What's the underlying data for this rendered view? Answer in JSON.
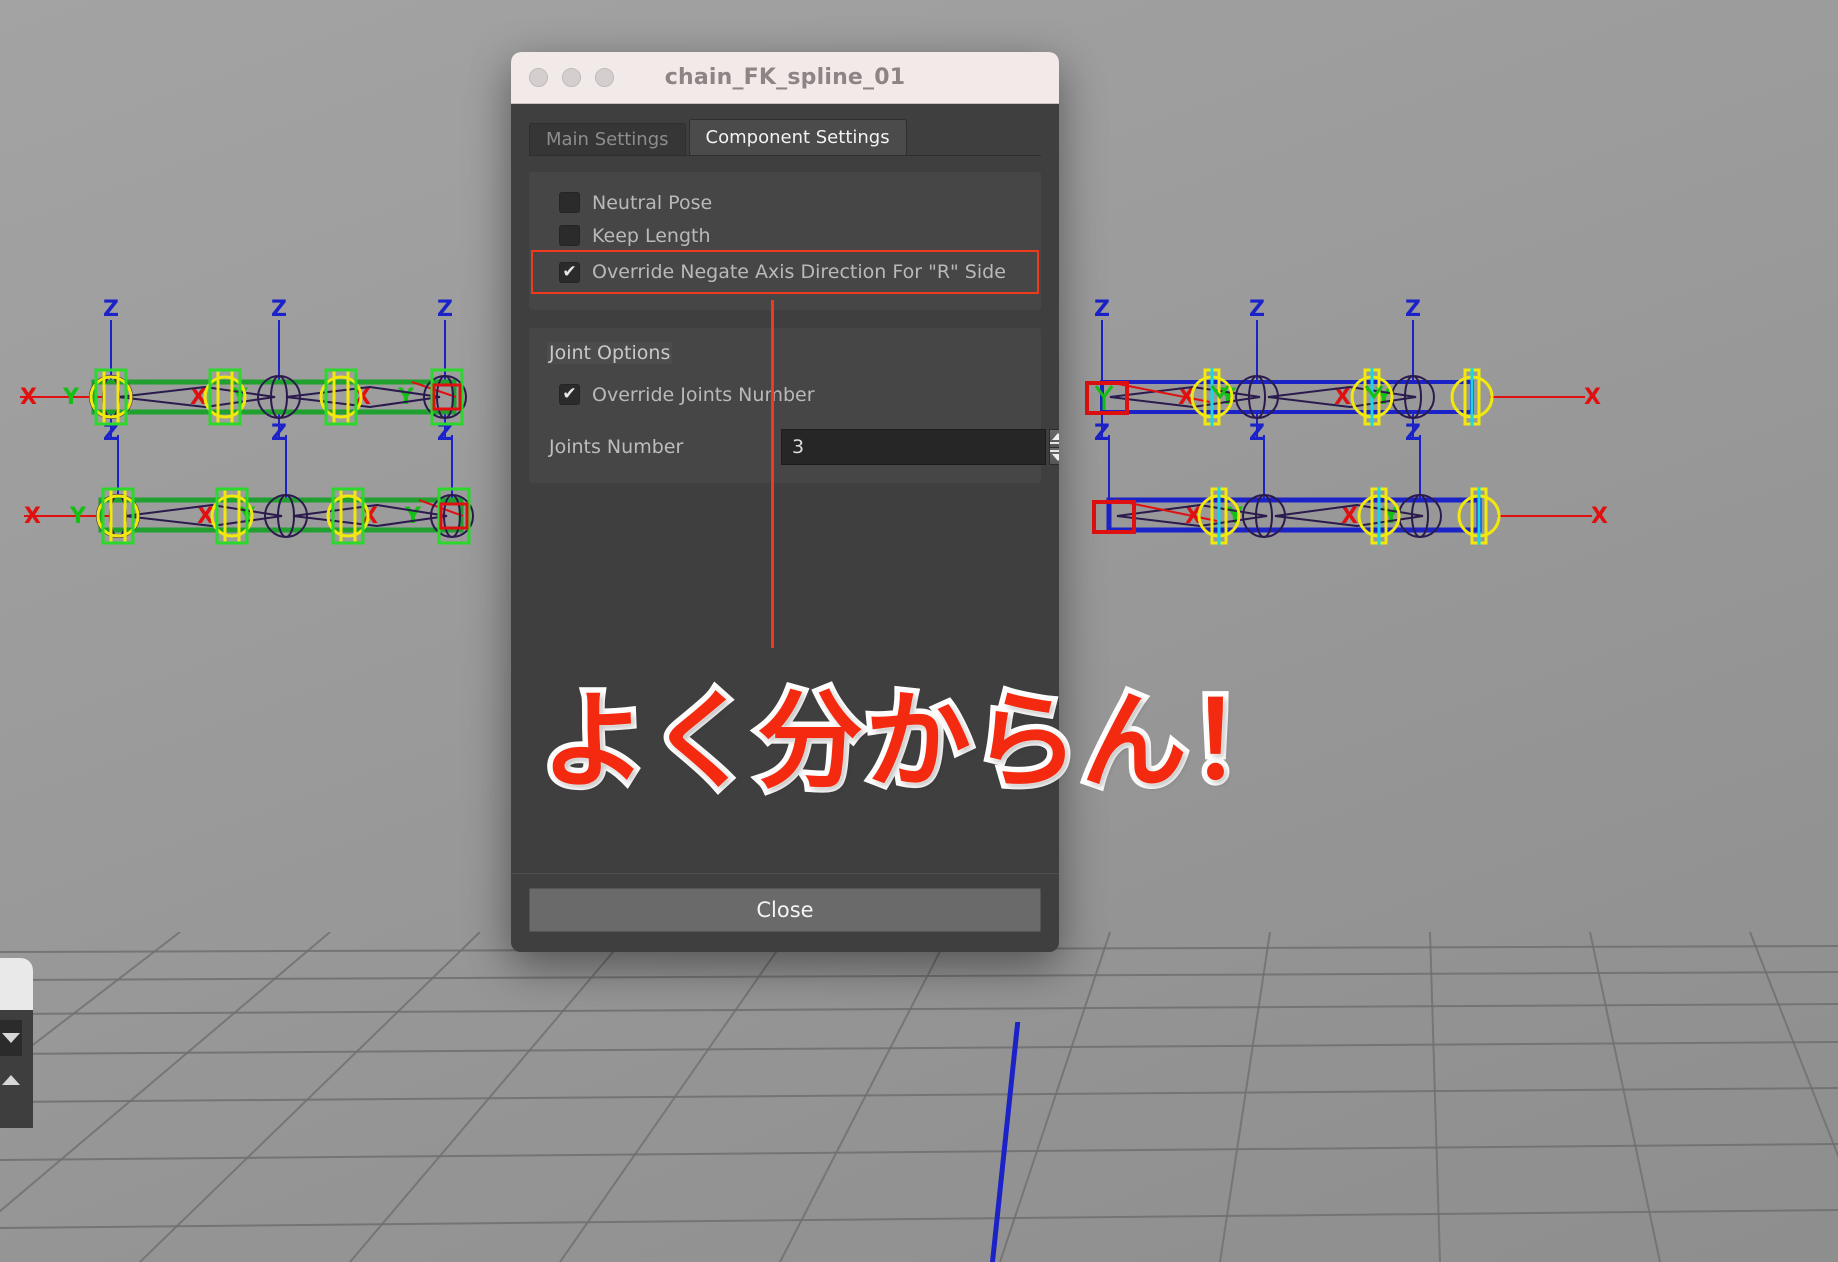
{
  "window": {
    "title": "chain_FK_spline_01",
    "traffic_lights": [
      "close",
      "minimize",
      "zoom"
    ]
  },
  "tabs": [
    {
      "label": "Main Settings",
      "active": false
    },
    {
      "label": "Component Settings",
      "active": true
    }
  ],
  "component_settings": {
    "checkboxes": [
      {
        "label": "Neutral Pose",
        "checked": false,
        "highlighted": false
      },
      {
        "label": "Keep Length",
        "checked": false,
        "highlighted": false
      },
      {
        "label": "Override Negate Axis Direction For \"R\" Side",
        "checked": true,
        "highlighted": true
      }
    ],
    "joint_options": {
      "title": "Joint Options",
      "override_joints_number": {
        "label": "Override Joints Number",
        "checked": true
      },
      "joints_number": {
        "label": "Joints Number",
        "value": "3"
      }
    }
  },
  "footer": {
    "close_label": "Close"
  },
  "overlay": {
    "caption": "よく分からん！",
    "caption_color": "#f42a10",
    "caption_outline": "#ffffff",
    "annotation_line_color": "#f33a18"
  },
  "viewport": {
    "left_rig": {
      "selection_color": "#1fa02f",
      "axis_labels": [
        "Z",
        "X",
        "Y",
        "Z",
        "X",
        "Z",
        "X"
      ],
      "joint_count": 4,
      "chain_rows": 2
    },
    "right_rig": {
      "selection_color": "#1a22c8",
      "axis_labels": [
        "Z",
        "X",
        "Y",
        "Z",
        "X",
        "Z",
        "X"
      ],
      "joint_count": 4,
      "chain_rows": 2
    },
    "axis_colors": {
      "x": "#e01010",
      "y": "#13c013",
      "z": "#1a22c8",
      "control": "#f2e80c",
      "bone": "#2b1a4d"
    },
    "background": "#9a9a9a"
  },
  "left_panel": {
    "scroll_down_icon": "triangle-down",
    "scroll_up_icon": "triangle-up"
  }
}
